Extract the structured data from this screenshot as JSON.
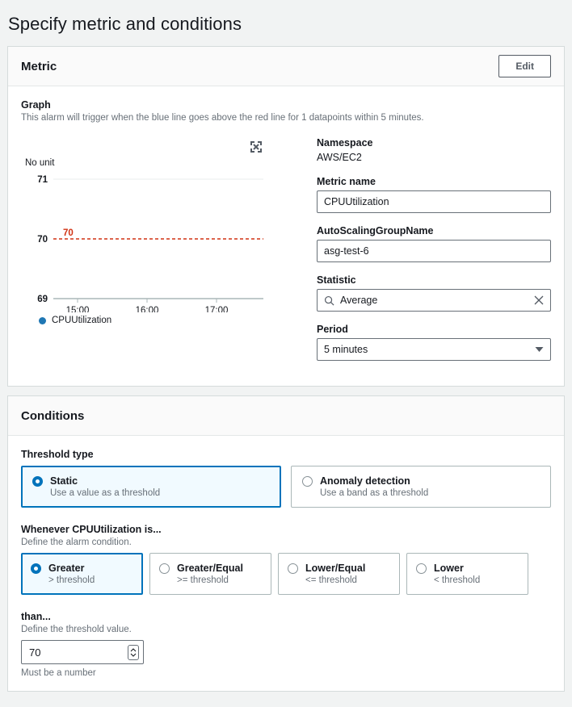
{
  "page": {
    "title": "Specify metric and conditions"
  },
  "metric_card": {
    "header_title": "Metric",
    "edit_label": "Edit",
    "graph": {
      "label": "Graph",
      "description": "This alarm will trigger when the blue line goes above the red line for 1 datapoints within 5 minutes.",
      "expand_icon": "expand-icon"
    },
    "fields": {
      "namespace_label": "Namespace",
      "namespace_value": "AWS/EC2",
      "metric_name_label": "Metric name",
      "metric_name_value": "CPUUtilization",
      "asg_label": "AutoScalingGroupName",
      "asg_value": "asg-test-6",
      "statistic_label": "Statistic",
      "statistic_value": "Average",
      "statistic_search_icon": "search-icon",
      "statistic_clear_icon": "close-icon",
      "period_label": "Period",
      "period_value": "5 minutes",
      "period_caret_icon": "chevron-down-icon"
    }
  },
  "conditions_card": {
    "header_title": "Conditions",
    "threshold_type_label": "Threshold type",
    "threshold_types": [
      {
        "title": "Static",
        "sub": "Use a value as a threshold",
        "selected": true
      },
      {
        "title": "Anomaly detection",
        "sub": "Use a band as a threshold",
        "selected": false
      }
    ],
    "whenever_label": "Whenever CPUUtilization is...",
    "whenever_sub": "Define the alarm condition.",
    "operators": [
      {
        "title": "Greater",
        "sub": "> threshold",
        "selected": true
      },
      {
        "title": "Greater/Equal",
        "sub": ">= threshold",
        "selected": false
      },
      {
        "title": "Lower/Equal",
        "sub": "<= threshold",
        "selected": false
      },
      {
        "title": "Lower",
        "sub": "< threshold",
        "selected": false
      }
    ],
    "than_label": "than...",
    "than_sub": "Define the threshold value.",
    "threshold_value": "70",
    "threshold_help": "Must be a number",
    "stepper_icon": "spinner-stepper-icon"
  },
  "chart_data": {
    "type": "line",
    "title": "",
    "unit_label": "No unit",
    "ylabel": "",
    "xlabel": "",
    "ylim": [
      69,
      71
    ],
    "ytick_labels": [
      "71",
      "70",
      "69"
    ],
    "yticks": [
      71,
      70,
      69
    ],
    "xtick_labels": [
      "15:00",
      "16:00",
      "17:00"
    ],
    "grid": true,
    "legend_position": "bottom-left",
    "series": [
      {
        "name": "CPUUtilization",
        "color": "#1f77b4",
        "values": []
      }
    ],
    "threshold": {
      "value": 70,
      "label": "70",
      "color": "#d13212",
      "style": "dashed"
    }
  },
  "colors": {
    "accent": "#0073bb",
    "threshold_red": "#d13212",
    "series_blue": "#1f77b4",
    "page_bg": "#f1f3f3"
  }
}
